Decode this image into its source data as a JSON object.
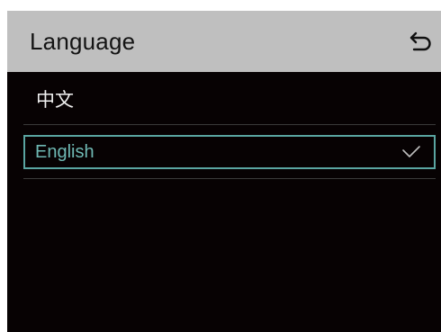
{
  "header": {
    "title": "Language",
    "back_icon": "back-arrow-icon"
  },
  "languages": [
    {
      "label": "中文",
      "selected": false
    },
    {
      "label": "English",
      "selected": true
    }
  ],
  "colors": {
    "header_bg": "#bfbfbf",
    "screen_bg": "#070203",
    "accent": "#5aa5a1",
    "selected_text": "#6fb9b4"
  },
  "icons": {
    "selected": "checkmark-icon"
  }
}
